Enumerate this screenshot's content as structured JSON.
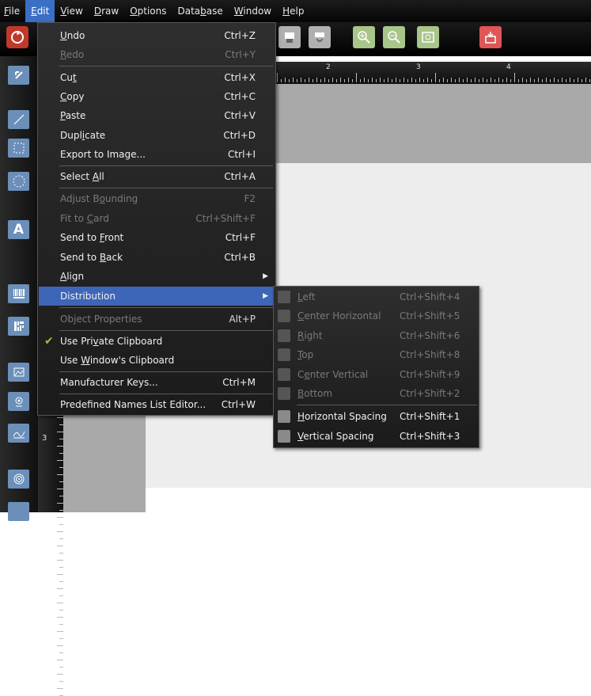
{
  "menubar": {
    "items": [
      {
        "pre": "",
        "acc": "F",
        "post": "ile"
      },
      {
        "pre": "",
        "acc": "E",
        "post": "dit"
      },
      {
        "pre": "",
        "acc": "V",
        "post": "iew"
      },
      {
        "pre": "",
        "acc": "D",
        "post": "raw"
      },
      {
        "pre": "",
        "acc": "O",
        "post": "ptions"
      },
      {
        "pre": "Data",
        "acc": "b",
        "post": "ase"
      },
      {
        "pre": "",
        "acc": "W",
        "post": "indow"
      },
      {
        "pre": "",
        "acc": "H",
        "post": "elp"
      }
    ]
  },
  "ruler_top": {
    "labels": [
      "2",
      "3",
      "4"
    ]
  },
  "ruler_left": {
    "labels": [
      "3"
    ]
  },
  "edit_menu": {
    "items": [
      {
        "pre": "",
        "acc": "U",
        "post": "ndo",
        "shortcut": "Ctrl+Z"
      },
      {
        "pre": "",
        "acc": "R",
        "post": "edo",
        "shortcut": "Ctrl+Y"
      },
      {
        "pre": "Cu",
        "acc": "t",
        "post": "",
        "shortcut": "Ctrl+X"
      },
      {
        "pre": "",
        "acc": "C",
        "post": "opy",
        "shortcut": "Ctrl+C"
      },
      {
        "pre": "",
        "acc": "P",
        "post": "aste",
        "shortcut": "Ctrl+V"
      },
      {
        "pre": "Dupl",
        "acc": "i",
        "post": "cate",
        "shortcut": "Ctrl+D"
      },
      {
        "pre": "Export to Image...",
        "acc": "",
        "post": "",
        "shortcut": "Ctrl+I"
      },
      {
        "pre": "Select ",
        "acc": "A",
        "post": "ll",
        "shortcut": "Ctrl+A"
      },
      {
        "pre": "Adjust B",
        "acc": "o",
        "post": "unding",
        "shortcut": "F2"
      },
      {
        "pre": "Fit to ",
        "acc": "C",
        "post": "ard",
        "shortcut": "Ctrl+Shift+F"
      },
      {
        "pre": "Send to ",
        "acc": "F",
        "post": "ront",
        "shortcut": "Ctrl+F"
      },
      {
        "pre": "Send to ",
        "acc": "B",
        "post": "ack",
        "shortcut": "Ctrl+B"
      },
      {
        "pre": "",
        "acc": "A",
        "post": "lign",
        "shortcut": ""
      },
      {
        "pre": "Distribution",
        "acc": "",
        "post": "",
        "shortcut": ""
      },
      {
        "pre": "Object Properties",
        "acc": "",
        "post": "",
        "shortcut": "Alt+P"
      },
      {
        "pre": "Use Pri",
        "acc": "v",
        "post": "ate Clipboard",
        "shortcut": ""
      },
      {
        "pre": "Use ",
        "acc": "W",
        "post": "indow's Clipboard",
        "shortcut": ""
      },
      {
        "pre": "Manufacturer Keys...",
        "acc": "",
        "post": "",
        "shortcut": "Ctrl+M"
      },
      {
        "pre": "Predefined Names List Editor...",
        "acc": "",
        "post": "",
        "shortcut": "Ctrl+W"
      }
    ]
  },
  "distribution_menu": {
    "items": [
      {
        "pre": "",
        "acc": "L",
        "post": "eft",
        "shortcut": "Ctrl+Shift+4"
      },
      {
        "pre": "",
        "acc": "C",
        "post": "enter Horizontal",
        "shortcut": "Ctrl+Shift+5"
      },
      {
        "pre": "",
        "acc": "R",
        "post": "ight",
        "shortcut": "Ctrl+Shift+6"
      },
      {
        "pre": "",
        "acc": "T",
        "post": "op",
        "shortcut": "Ctrl+Shift+8"
      },
      {
        "pre": "C",
        "acc": "e",
        "post": "nter Vertical",
        "shortcut": "Ctrl+Shift+9"
      },
      {
        "pre": "",
        "acc": "B",
        "post": "ottom",
        "shortcut": "Ctrl+Shift+2"
      },
      {
        "pre": "",
        "acc": "H",
        "post": "orizontal Spacing",
        "shortcut": "Ctrl+Shift+1"
      },
      {
        "pre": "",
        "acc": "V",
        "post": "ertical Spacing",
        "shortcut": "Ctrl+Shift+3"
      }
    ]
  }
}
